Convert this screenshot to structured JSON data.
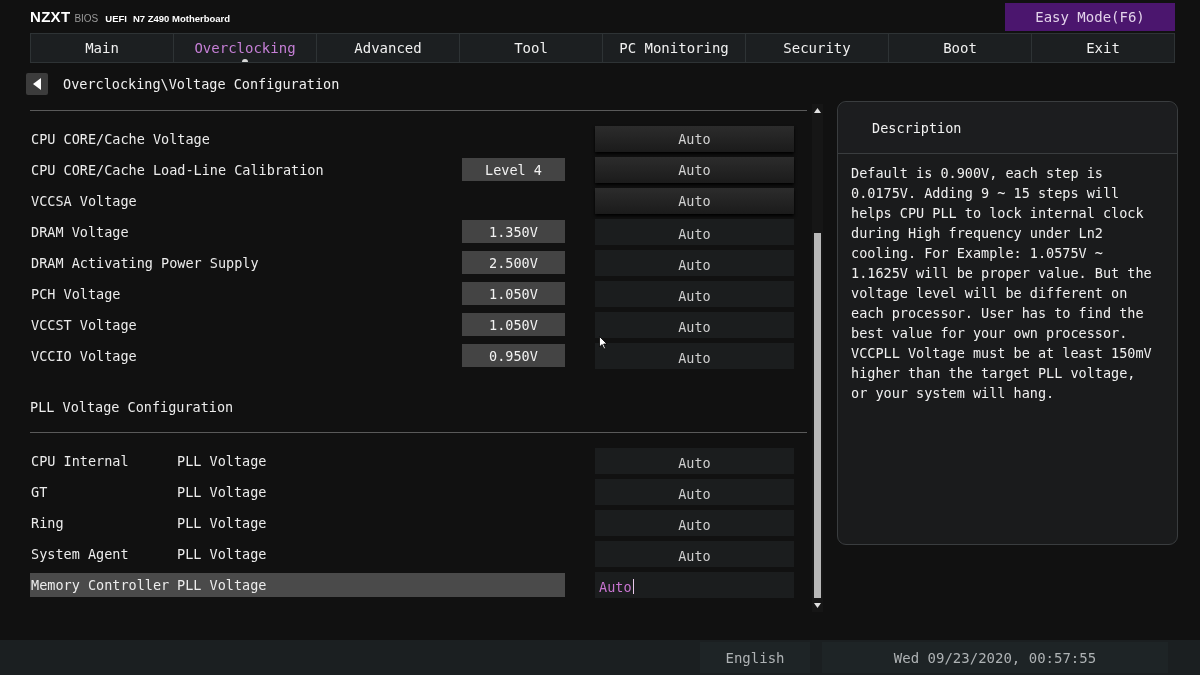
{
  "header": {
    "logo": "NZXT",
    "logo_sub": "BIOS",
    "firmware": "UEFI",
    "board": "N7 Z490 Motherboard",
    "mode_button": "Easy Mode(F6)"
  },
  "tabs": [
    {
      "label": "Main",
      "selected": false
    },
    {
      "label": "Overclocking",
      "selected": true
    },
    {
      "label": "Advanced",
      "selected": false
    },
    {
      "label": "Tool",
      "selected": false
    },
    {
      "label": "PC Monitoring",
      "selected": false
    },
    {
      "label": "Security",
      "selected": false
    },
    {
      "label": "Boot",
      "selected": false
    },
    {
      "label": "Exit",
      "selected": false
    }
  ],
  "breadcrumb": {
    "path": "Overclocking\\Voltage Configuration"
  },
  "settings": [
    {
      "label": "CPU CORE/Cache Voltage",
      "option": "Auto",
      "kind": "select",
      "selected": false
    },
    {
      "label": "CPU CORE/Cache Load-Line Calibration",
      "value": "Level 4",
      "option": "Auto",
      "kind": "select",
      "selected": false
    },
    {
      "label": "VCCSA Voltage",
      "option": "Auto",
      "kind": "select",
      "selected": false
    },
    {
      "label": "DRAM Voltage",
      "value": "1.350V",
      "option": "Auto",
      "kind": "field",
      "selected": false
    },
    {
      "label": "DRAM Activating Power Supply",
      "value": "2.500V",
      "option": "Auto",
      "kind": "field",
      "selected": false
    },
    {
      "label": "PCH Voltage",
      "value": "1.050V",
      "option": "Auto",
      "kind": "field",
      "selected": false
    },
    {
      "label": "VCCST Voltage",
      "value": "1.050V",
      "option": "Auto",
      "kind": "field",
      "selected": false
    },
    {
      "label": "VCCIO Voltage",
      "value": "0.950V",
      "option": "Auto",
      "kind": "field",
      "selected": false
    }
  ],
  "pll_section": {
    "title": "PLL Voltage Configuration",
    "rows": [
      {
        "label": "CPU Internal",
        "sublabel": "PLL Voltage",
        "option": "Auto",
        "kind": "field",
        "selected": false
      },
      {
        "label": "GT",
        "sublabel": "PLL Voltage",
        "option": "Auto",
        "kind": "field",
        "selected": false
      },
      {
        "label": "Ring",
        "sublabel": "PLL Voltage",
        "option": "Auto",
        "kind": "field",
        "selected": false
      },
      {
        "label": "System Agent",
        "sublabel": "PLL Voltage",
        "option": "Auto",
        "kind": "field",
        "selected": false
      },
      {
        "label": "Memory Controller",
        "sublabel": "PLL Voltage",
        "option": "Auto",
        "kind": "field",
        "selected": true
      }
    ]
  },
  "description": {
    "title": "Description",
    "text": "Default is 0.900V, each step is 0.0175V. Adding 9 ~ 15 steps will helps CPU PLL to lock internal clock during High frequency under Ln2 cooling. For Example: 1.0575V ~ 1.1625V will be proper value. But the voltage level will be different on each processor. User has to find the best value for your own processor. VCCPLL Voltage must be at least 150mV higher than the target PLL voltage, or your system will hang."
  },
  "status_bar": {
    "language": "English",
    "datetime": "Wed 09/23/2020, 00:57:55"
  }
}
